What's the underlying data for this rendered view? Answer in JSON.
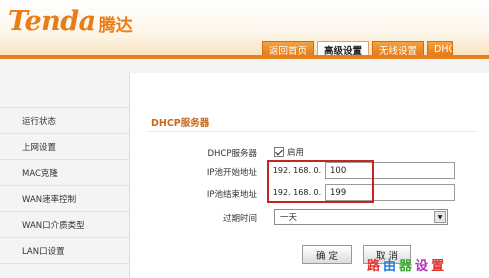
{
  "header": {
    "brand_en": "Tenda",
    "brand_cn": "腾达",
    "tabs": [
      {
        "label": "返回首页"
      },
      {
        "label": "高级设置",
        "active": true
      },
      {
        "label": "无线设置"
      },
      {
        "label": "DHCP"
      }
    ]
  },
  "sidebar": {
    "items": [
      {
        "label": "运行状态"
      },
      {
        "label": "上网设置"
      },
      {
        "label": "MAC克隆"
      },
      {
        "label": "WAN速率控制"
      },
      {
        "label": "WAN口介质类型"
      },
      {
        "label": "LAN口设置"
      }
    ]
  },
  "dhcp": {
    "section_title": "DHCP服务器",
    "server_label": "DHCP服务器",
    "enable_label": "启用",
    "enable_checked": true,
    "start_label": "IP池开始地址",
    "end_label": "IP池结束地址",
    "ip_prefix": "192. 168. 0.",
    "start_value": "100",
    "end_value": "199",
    "lease_label": "过期时间",
    "lease_value": "一天"
  },
  "buttons": {
    "ok": "确 定",
    "cancel": "取 消"
  },
  "watermark": {
    "chars": [
      "路",
      "由",
      "器",
      "设",
      "置"
    ]
  },
  "colors": {
    "brand_orange": "#e97c16",
    "highlight_red": "#c82323",
    "section_title": "#c8691a"
  }
}
